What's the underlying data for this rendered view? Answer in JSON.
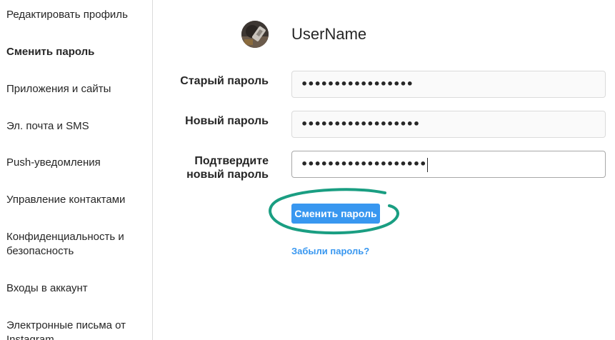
{
  "sidebar": {
    "items": [
      {
        "label": "Редактировать профиль"
      },
      {
        "label": "Сменить пароль"
      },
      {
        "label": "Приложения и сайты"
      },
      {
        "label": "Эл. почта и SMS"
      },
      {
        "label": "Push-уведомления"
      },
      {
        "label": "Управление контактами"
      },
      {
        "label": "Конфиденциальность и безопасность"
      },
      {
        "label": "Входы в аккаунт"
      },
      {
        "label": "Электронные письма от Instagram"
      }
    ],
    "active_index": 1
  },
  "profile": {
    "username": "UserName"
  },
  "form": {
    "old_password": {
      "label": "Старый пароль",
      "value": "•••••••••••••••••"
    },
    "new_password": {
      "label": "Новый пароль",
      "value": "••••••••••••••••••"
    },
    "confirm_password": {
      "label_line1": "Подтвердите",
      "label_line2": "новый пароль",
      "value": "•••••••••••••••••••"
    },
    "submit_label": "Сменить пароль",
    "forgot_label": "Забыли пароль?"
  },
  "colors": {
    "accent": "#3897f0",
    "highlight_ring": "#1a9e82",
    "border": "#dbdbdb"
  }
}
